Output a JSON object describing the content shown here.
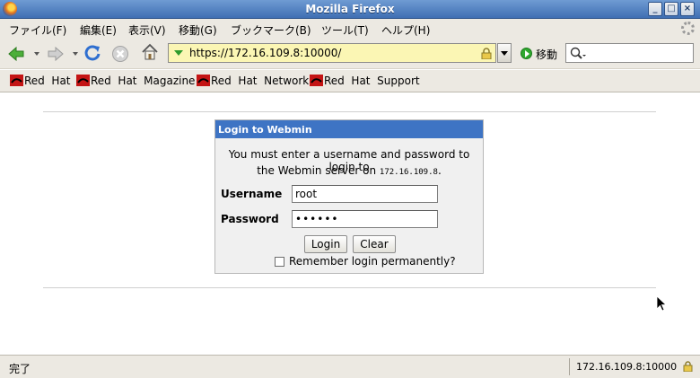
{
  "window": {
    "title": "Mozilla Firefox",
    "buttons": {
      "minimize": "_",
      "maximize": "□",
      "close": "×"
    }
  },
  "menu": {
    "items": [
      "ファイル(F)",
      "編集(E)",
      "表示(V)",
      "移動(G)",
      "ブックマーク(B)",
      "ツール(T)",
      "ヘルプ(H)"
    ]
  },
  "navbar": {
    "url": "https://172.16.109.8:10000/",
    "go_label": "移動",
    "icons": [
      "back-icon",
      "forward-icon",
      "reload-icon",
      "stop-icon",
      "home-icon",
      "go-icon",
      "search-icon"
    ]
  },
  "bookmarks": {
    "items": [
      "Red  Hat",
      "Red  Hat  Magazine",
      "Red  Hat  Network",
      "Red  Hat  Support"
    ]
  },
  "login": {
    "heading": "Login to Webmin",
    "message_line1": "You must enter a username and password to login to",
    "message_line2_prefix": "the Webmin server on ",
    "server_ip": "172.16.109.8",
    "message_line2_suffix": ".",
    "username_label": "Username",
    "username_value": "root",
    "password_label": "Password",
    "password_value": "••••••",
    "login_button": "Login",
    "clear_button": "Clear",
    "remember_label": "Remember login permanently?",
    "remember_checked": false
  },
  "status": {
    "text": "完了",
    "address": "172.16.109.8:10000"
  },
  "colors": {
    "titlebar": "#4f7fc0",
    "login_header": "#3e74c4",
    "url_bg": "#fbf6b4"
  }
}
